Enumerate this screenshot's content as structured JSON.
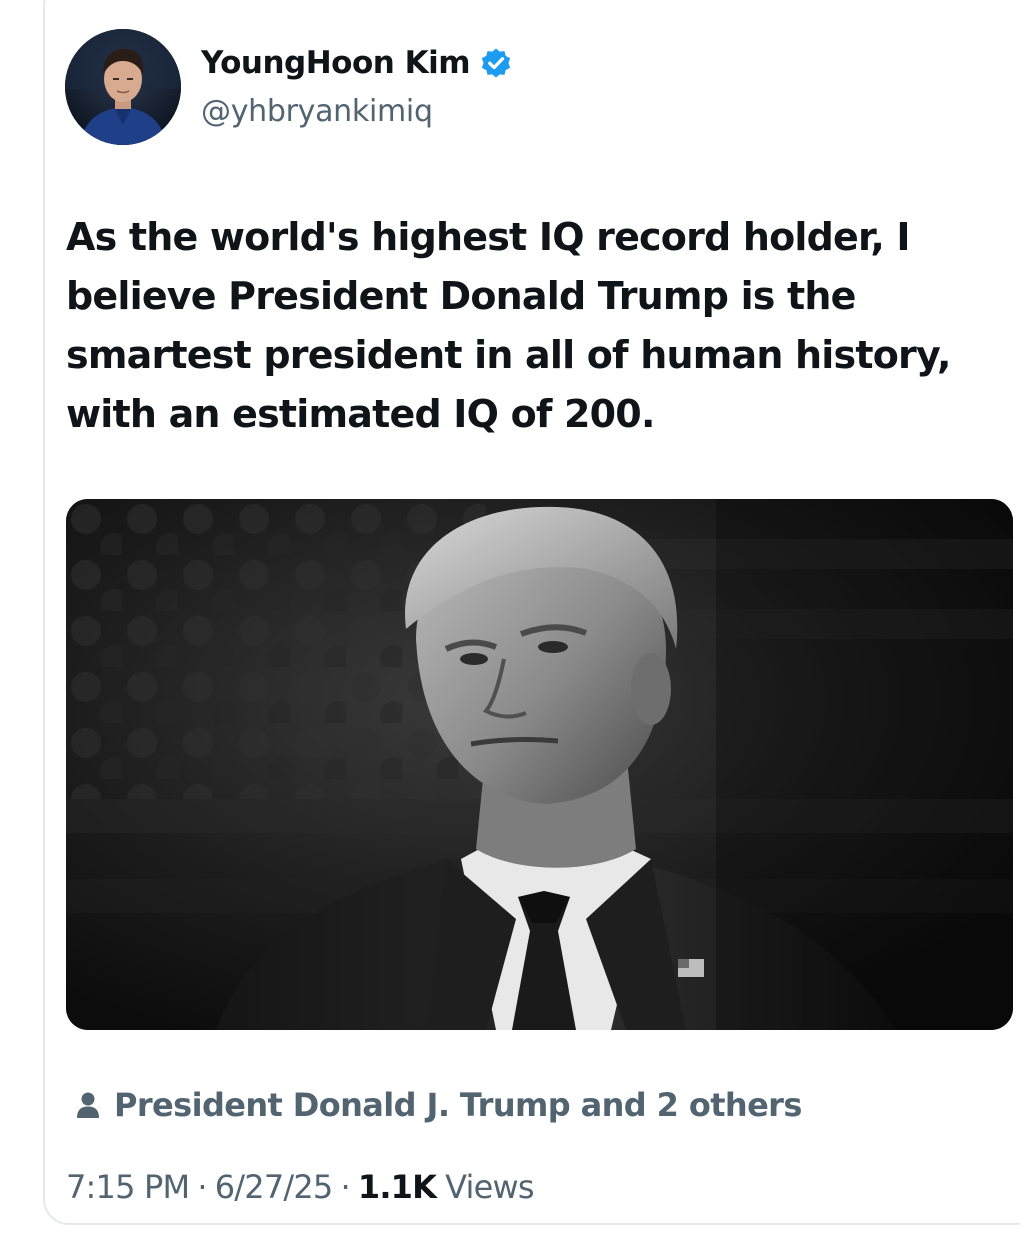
{
  "author": {
    "name": "YoungHoon Kim",
    "handle": "@yhbryankimiq",
    "verified": true,
    "avatar_icon": "avatar-photo"
  },
  "tweet": {
    "text": "As the world's highest IQ record holder, I believe President Donald Trump is the smartest president in all of human history, with an estimated IQ of 200.",
    "media_icon": "photo"
  },
  "tagged": {
    "icon": "person-icon",
    "text": "President Donald J. Trump and 2 others"
  },
  "meta": {
    "time": "7:15 PM",
    "separator": "·",
    "date": "6/27/25",
    "views_count": "1.1K",
    "views_label": "Views"
  },
  "colors": {
    "text_primary": "#0f1419",
    "text_secondary": "#536471",
    "verified_blue": "#1d9bf0",
    "border": "#e6e9ec"
  }
}
